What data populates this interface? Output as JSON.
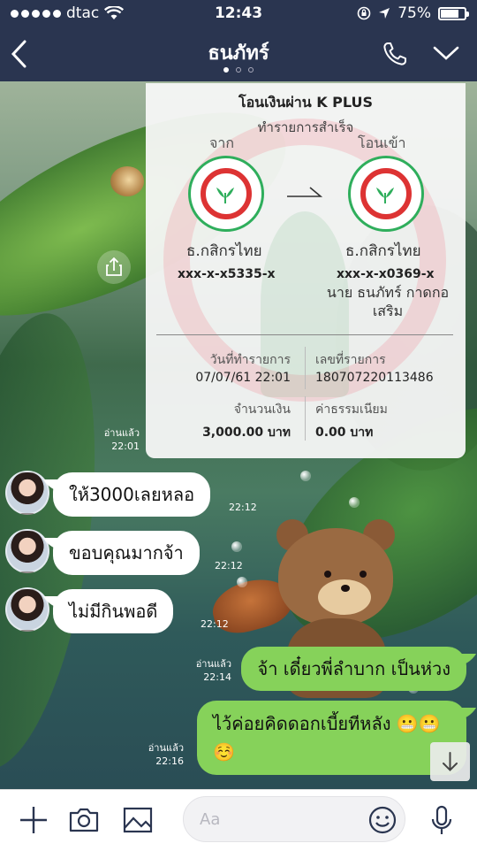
{
  "status_bar": {
    "carrier": "dtac",
    "time": "12:43",
    "battery": "75%",
    "battery_level": 0.75
  },
  "header": {
    "title": "ธนภัทร์",
    "page_dots": 3,
    "active_dot": 0
  },
  "transfer_slip": {
    "title": "โอนเงินผ่าน K PLUS",
    "status": "ทำรายการสำเร็จ",
    "from_label": "จาก",
    "to_label": "โอนเข้า",
    "from_bank": "ธ.กสิกรไทย",
    "to_bank": "ธ.กสิกรไทย",
    "from_account": "xxx-x-x5335-x",
    "to_account": "xxx-x-x0369-x",
    "to_name": "นาย ธนภัทร์ กาดกอเสริม",
    "date_label": "วันที่ทำรายการ",
    "date_value": "07/07/61 22:01",
    "ref_label": "เลขที่รายการ",
    "ref_value": "180707220113486",
    "amount_label": "จำนวนเงิน",
    "amount_value": "3,000.00 บาท",
    "fee_label": "ค่าธรรมเนียม",
    "fee_value": "0.00 บาท",
    "read_label": "อ่านแล้ว",
    "time": "22:01"
  },
  "messages": [
    {
      "side": "in",
      "text": "ให้3000เลยหลอ",
      "time": "22:12"
    },
    {
      "side": "in",
      "text": "ขอบคุณมากจ้า",
      "time": "22:12"
    },
    {
      "side": "in",
      "text": "ไม่มีกินพอดี",
      "time": "22:12"
    },
    {
      "side": "out",
      "text": "จ้า เดี๋ยวพี่ลำบาก เป็นห่วง",
      "read": "อ่านแล้ว",
      "time": "22:14"
    },
    {
      "side": "out",
      "text": "ไว้ค่อยคิดดอกเบี้ยทีหลัง 😬😬☺️",
      "read": "อ่านแล้ว",
      "time": "22:16"
    }
  ],
  "input": {
    "placeholder": "Aa"
  },
  "icons": {
    "back": "chevron-left-icon",
    "phone": "phone-icon",
    "menu": "chevron-down-icon",
    "share": "share-icon",
    "add": "plus-icon",
    "camera": "camera-icon",
    "image": "image-icon",
    "emoji": "emoji-icon",
    "mic": "microphone-icon",
    "scroll": "arrow-down-icon"
  },
  "colors": {
    "header_bg": "#2a3550",
    "outgoing_bubble": "#86d25a",
    "incoming_bubble": "#ffffff",
    "kbank_green": "#2fae5c"
  }
}
